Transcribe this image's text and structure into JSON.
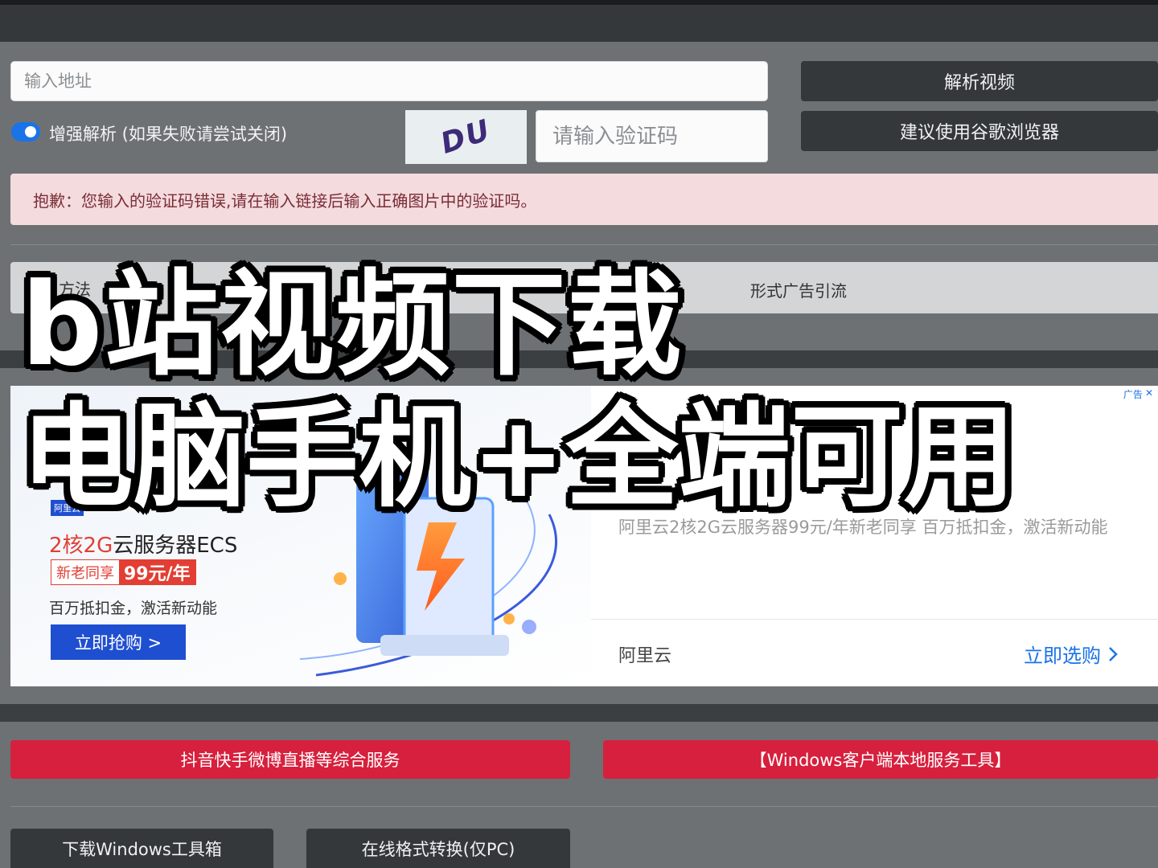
{
  "search": {
    "url_placeholder": "输入地址",
    "captcha_placeholder": "请输入验证码",
    "captcha_code": "DU"
  },
  "buttons": {
    "parse_video": "解析视频",
    "browser_hint": "建议使用谷歌浏览器"
  },
  "toggle": {
    "label": "增强解析 (如果失败请尝试关闭)",
    "enabled": true
  },
  "alert": {
    "message": "抱歉：您输入的验证码错误,请在输入链接后输入正确图片中的验证吗。"
  },
  "notice": {
    "left_text": "方法",
    "right_text": "形式广告引流"
  },
  "ad": {
    "badge": "阿里云",
    "title_main": "2核2G",
    "title_rest": "云服务器ECS",
    "price_label": "新老同享",
    "price_value": "99元/年",
    "subtitle": "百万抵扣金，激活新动能",
    "cta": "立即抢购 >",
    "description": "阿里云2核2G云服务器99元/年新老同享 百万抵扣金，激活新动能",
    "advertiser": "阿里云",
    "buy_link": "立即选购",
    "corner_label": "广告",
    "corner_close": "✕"
  },
  "service_buttons": {
    "douyin": "抖音快手微博直播等综合服务",
    "windows_client": "【Windows客户端本地服务工具】"
  },
  "bottom_buttons": {
    "download_toolbox": "下载Windows工具箱",
    "format_convert": "在线格式转换(仅PC)"
  },
  "overlay": {
    "line1": "b站视频下载",
    "line2": "电脑手机+全端可用"
  },
  "colors": {
    "brand_blue": "#1a73e8",
    "alert_bg": "#f4dbde",
    "service_red": "#d6203d",
    "dark_button": "#34383b"
  }
}
